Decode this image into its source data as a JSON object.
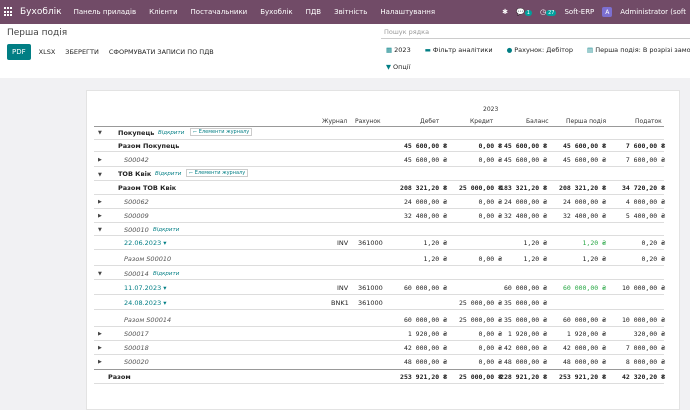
{
  "topbar": {
    "app_name": "Бухоблік",
    "menu": [
      "Панель приладів",
      "Клієнти",
      "Постачальники",
      "Бухоблік",
      "ПДВ",
      "Звітність",
      "Налаштування"
    ],
    "chat_count": "1",
    "activity_count": "27",
    "company": "Soft-ERP",
    "avatar_letter": "A",
    "user": "Administrator (soft"
  },
  "control": {
    "title": "Перша подія",
    "pdf": "PDF",
    "xlsx": "XLSX",
    "save": "ЗБЕРЕГТИ",
    "vat": "СФОРМУВАТИ ЗАПИСИ ПО ПДВ",
    "search_placeholder": "Пошук рядка",
    "year": "2023",
    "analytics": "Фільтр аналітики",
    "account": "Рахунок: Дебітор",
    "first_event": "Перша подія:",
    "first_event_value": "В розрізі замовлення",
    "options": "Опції"
  },
  "report": {
    "year": "2023",
    "columns": [
      "Журнал",
      "Рахунок",
      "Дебет",
      "Кредит",
      "Баланс",
      "Перша подія",
      "Податок"
    ],
    "open": "Відкрити",
    "journal_items": "Елементи журналу",
    "groups": {
      "g1": "Покупець",
      "g1_total": "Разом Покупець",
      "g2": "ТОВ Квік",
      "g2_total": "Разом ТОВ Квік",
      "total": "Разом"
    },
    "rows": {
      "r1": {
        "label": "Разом Покупець",
        "debit": "45 600,00 ₴",
        "credit": "0,00 ₴",
        "balance": "45 600,00 ₴",
        "first": "45 600,00 ₴",
        "tax": "7 600,00 ₴"
      },
      "r2": {
        "label": "S00042",
        "debit": "45 600,00 ₴",
        "credit": "0,00 ₴",
        "balance": "45 600,00 ₴",
        "first": "45 600,00 ₴",
        "tax": "7 600,00 ₴"
      },
      "r3": {
        "label": "Разом ТОВ Квік",
        "debit": "208 321,20 ₴",
        "credit": "25 000,00 ₴",
        "balance": "183 321,20 ₴",
        "first": "208 321,20 ₴",
        "tax": "34 720,20 ₴"
      },
      "r4": {
        "label": "S00062",
        "debit": "24 000,00 ₴",
        "credit": "0,00 ₴",
        "balance": "24 000,00 ₴",
        "first": "24 000,00 ₴",
        "tax": "4 000,00 ₴"
      },
      "r5": {
        "label": "S00009",
        "debit": "32 400,00 ₴",
        "credit": "0,00 ₴",
        "balance": "32 400,00 ₴",
        "first": "32 400,00 ₴",
        "tax": "5 400,00 ₴"
      },
      "r6": {
        "label": "S00010"
      },
      "r7": {
        "date": "22.06.2023",
        "journal": "INV",
        "account": "361000",
        "debit": "1,20 ₴",
        "balance": "1,20 ₴",
        "first": "1,20 ₴",
        "tax": "0,20 ₴"
      },
      "r8": {
        "label": "Разом S00010",
        "debit": "1,20 ₴",
        "credit": "0,00 ₴",
        "balance": "1,20 ₴",
        "first": "1,20 ₴",
        "tax": "0,20 ₴"
      },
      "r9": {
        "label": "S00014"
      },
      "r10": {
        "date": "11.07.2023",
        "journal": "INV",
        "account": "361000",
        "debit": "60 000,00 ₴",
        "balance": "60 000,00 ₴",
        "first": "60 000,00 ₴",
        "tax": "10 000,00 ₴"
      },
      "r11": {
        "date": "24.08.2023",
        "journal": "BNK1",
        "account": "361000",
        "credit": "25 000,00 ₴",
        "balance": "35 000,00 ₴"
      },
      "r12": {
        "label": "Разом S00014",
        "debit": "60 000,00 ₴",
        "credit": "25 000,00 ₴",
        "balance": "35 000,00 ₴",
        "first": "60 000,00 ₴",
        "tax": "10 000,00 ₴"
      },
      "r13": {
        "label": "S00017",
        "debit": "1 920,00 ₴",
        "credit": "0,00 ₴",
        "balance": "1 920,00 ₴",
        "first": "1 920,00 ₴",
        "tax": "320,00 ₴"
      },
      "r14": {
        "label": "S00018",
        "debit": "42 000,00 ₴",
        "credit": "0,00 ₴",
        "balance": "42 000,00 ₴",
        "first": "42 000,00 ₴",
        "tax": "7 000,00 ₴"
      },
      "r15": {
        "label": "S00020",
        "debit": "48 000,00 ₴",
        "credit": "0,00 ₴",
        "balance": "48 000,00 ₴",
        "first": "48 000,00 ₴",
        "tax": "8 000,00 ₴"
      },
      "r16": {
        "label": "Разом",
        "debit": "253 921,20 ₴",
        "credit": "25 000,00 ₴",
        "balance": "228 921,20 ₴",
        "first": "253 921,20 ₴",
        "tax": "42 320,20 ₴"
      }
    }
  }
}
